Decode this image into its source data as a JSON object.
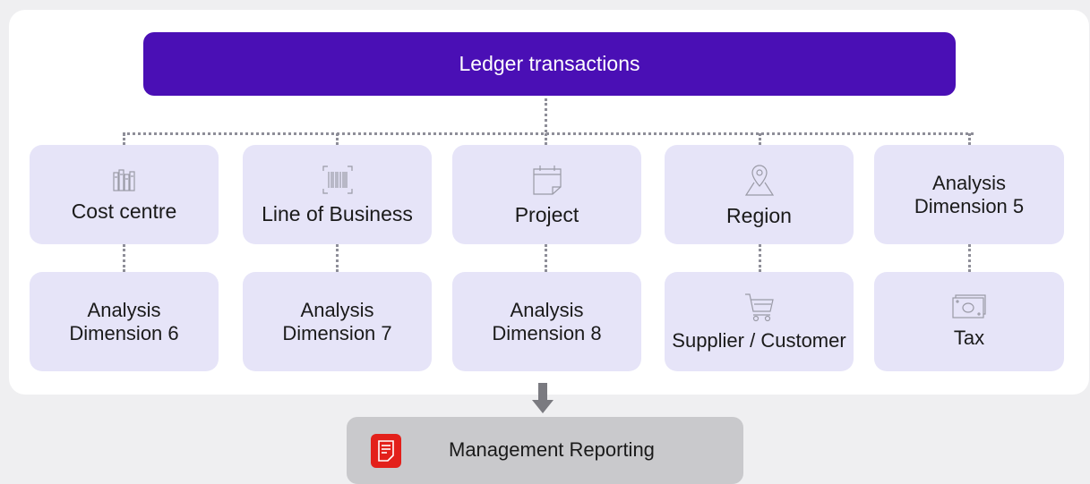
{
  "ledger": {
    "label": "Ledger transactions"
  },
  "top_row": [
    {
      "label": "Cost centre",
      "icon": "books-icon"
    },
    {
      "label": "Line of Business",
      "icon": "barcode-icon"
    },
    {
      "label": "Project",
      "icon": "calendar-icon"
    },
    {
      "label": "Region",
      "icon": "map-pin-icon"
    },
    {
      "label_line1": "Analysis",
      "label_line2": "Dimension 5"
    }
  ],
  "bottom_row": [
    {
      "label_line1": "Analysis",
      "label_line2": "Dimension 6"
    },
    {
      "label_line1": "Analysis",
      "label_line2": "Dimension 7"
    },
    {
      "label_line1": "Analysis",
      "label_line2": "Dimension 8"
    },
    {
      "label": "Supplier / Customer",
      "icon": "shopping-cart-icon"
    },
    {
      "label": "Tax",
      "icon": "banknote-icon"
    }
  ],
  "output": {
    "label": "Management Reporting",
    "icon": "report-document-icon"
  },
  "colors": {
    "ledger_bg": "#4a0fb5",
    "box_bg": "#e6e4f8",
    "report_icon_bg": "#e3201b",
    "report_bg": "#c9c9cc",
    "connector": "#8e8e98"
  }
}
